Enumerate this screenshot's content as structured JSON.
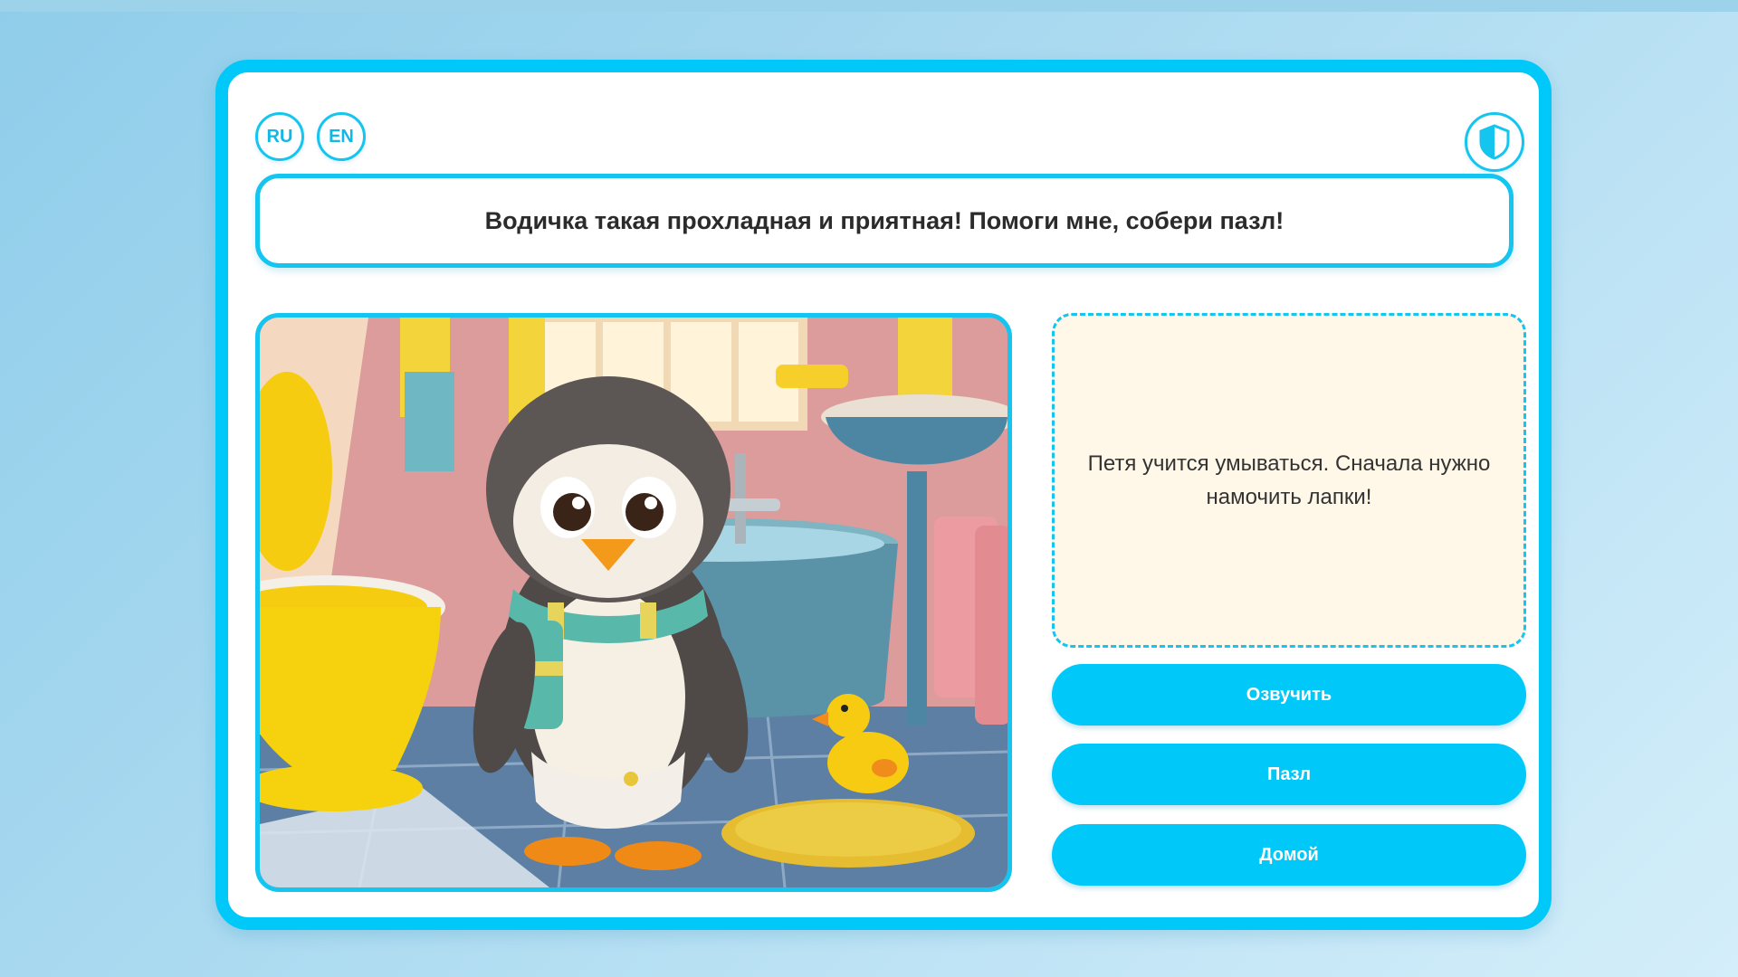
{
  "header": {
    "languages": [
      {
        "code": "RU",
        "label": "RU"
      },
      {
        "code": "EN",
        "label": "EN"
      }
    ],
    "shield_icon": "shield-icon"
  },
  "message": {
    "text": "Водичка такая прохладная и приятная! Помоги мне, собери пазл!"
  },
  "illustration": {
    "subject_icon": "penguin-in-bathroom-illustration"
  },
  "story_panel": {
    "text": "Петя учится умываться. Сначала нужно намочить лапки!"
  },
  "actions": {
    "voice_label": "Озвучить",
    "puzzle_label": "Пазл",
    "home_label": "Домой"
  },
  "colors": {
    "accent": "#00c8f8",
    "panel_background": "#fff8e8",
    "page_background": "#a9dbf0"
  }
}
